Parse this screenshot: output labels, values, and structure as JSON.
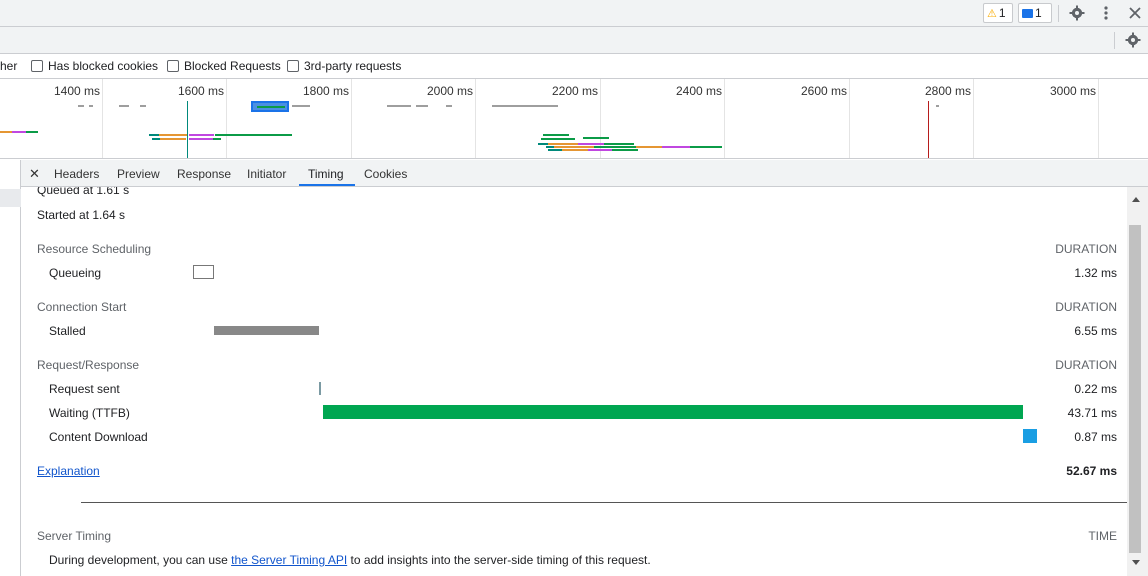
{
  "toolbar": {
    "warning_count": "1",
    "message_count": "1",
    "icons": [
      "warning-icon",
      "message-icon",
      "gear-icon",
      "more-vert-icon",
      "close-icon"
    ]
  },
  "filters": {
    "partial_label": "her",
    "items": [
      "Has blocked cookies",
      "Blocked Requests",
      "3rd-party requests"
    ]
  },
  "overview": {
    "ticks": [
      "1400 ms",
      "1600 ms",
      "1800 ms",
      "2000 ms",
      "2200 ms",
      "2400 ms",
      "2600 ms",
      "2800 ms",
      "3000 ms"
    ],
    "colors": {
      "blue": "#1a73e8",
      "green": "#0b9b47",
      "orange": "#e59633",
      "purple": "#c047e0",
      "teal": "#00897b",
      "red": "#b71c1c",
      "gray": "#9e9e9e"
    }
  },
  "tabs": [
    "Headers",
    "Preview",
    "Response",
    "Initiator",
    "Timing",
    "Cookies"
  ],
  "active_tab": "Timing",
  "timing": {
    "queued_label": "Queued at 1.61 s",
    "started_label": "Started at 1.64 s",
    "sections": [
      {
        "title": "Resource Scheduling",
        "header": "DURATION",
        "rows": [
          {
            "label": "Queueing",
            "value": "1.32 ms"
          }
        ]
      },
      {
        "title": "Connection Start",
        "header": "DURATION",
        "rows": [
          {
            "label": "Stalled",
            "value": "6.55 ms"
          }
        ]
      },
      {
        "title": "Request/Response",
        "header": "DURATION",
        "rows": [
          {
            "label": "Request sent",
            "value": "0.22 ms"
          },
          {
            "label": "Waiting (TTFB)",
            "value": "43.71 ms"
          },
          {
            "label": "Content Download",
            "value": "0.87 ms"
          }
        ]
      }
    ],
    "explanation_link": "Explanation",
    "total": "52.67 ms",
    "server_timing": {
      "title": "Server Timing",
      "header": "TIME",
      "text_before": "During development, you can use ",
      "link": "the Server Timing API",
      "text_after": " to add insights into the server-side timing of this request."
    },
    "bar_colors": {
      "stalled": "#888888",
      "request_sent": "#7b9aa3",
      "waiting": "#00a651",
      "download": "#1a9ee3"
    }
  }
}
